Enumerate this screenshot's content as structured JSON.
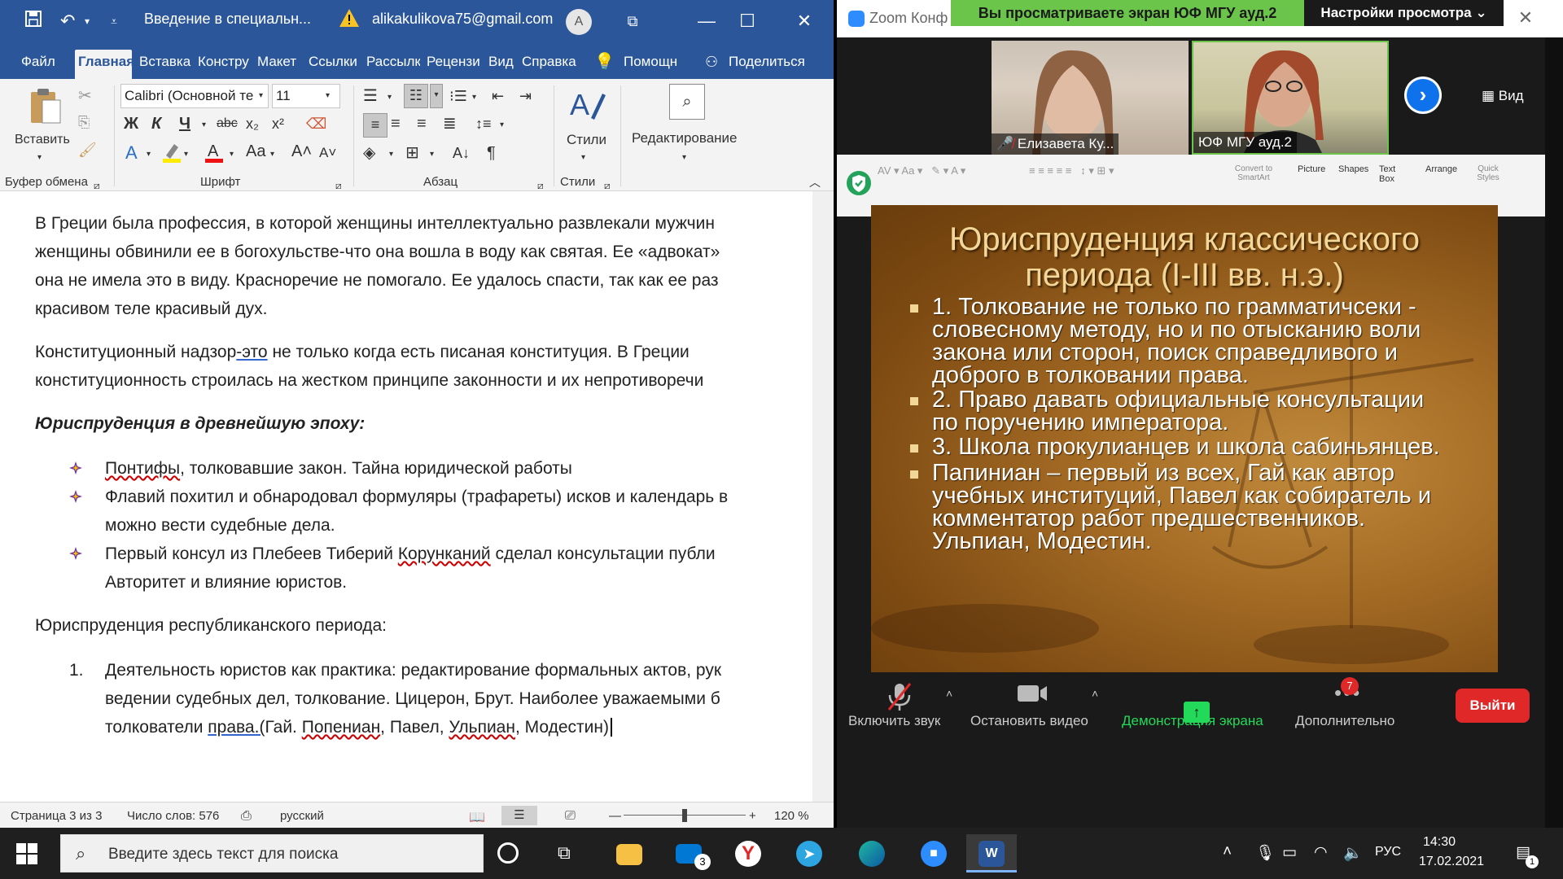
{
  "word": {
    "doc_title": "Введение в специальн...",
    "account_email": "alikakulikova75@gmail.com",
    "avatar_initial": "A",
    "tabs": [
      "Файл",
      "Главная",
      "Вставка",
      "Констру",
      "Макет",
      "Ссылки",
      "Рассылк",
      "Рецензи",
      "Вид",
      "Справка"
    ],
    "help_label": "Помощн",
    "share_label": "Поделиться",
    "ribbon": {
      "paste_label": "Вставить",
      "clipboard_group": "Буфер обмена",
      "font_group": "Шрифт",
      "paragraph_group": "Абзац",
      "styles_group": "Стили",
      "styles_label": "Стили",
      "editing_label": "Редактирование",
      "font_name": "Calibri (Основной те",
      "font_size": "11"
    },
    "document": {
      "p1_lines": [
        "В Греции была профессия, в которой женщины интеллектуально развлекали мужчин",
        "женщины обвинили ее в богохульстве-что она вошла в воду как святая. Ее «адвокат»",
        "она не имела это в виду. Красноречие не помогало. Ее удалось спасти, так как ее раз",
        "красивом теле красивый дух."
      ],
      "p2_a": "Конституционный надзор",
      "p2_b": "-это",
      "p2_c": " не только когда есть писаная конституция. В Греции",
      "p2_line2": "конституционность строилась на жестком принципе законности и их непротиворечи",
      "heading1": "Юриспруденция в древнейшую эпоху:",
      "b1_a": "Понтифы",
      "b1_b": ", толковавшие закон. Тайна юридической работы",
      "b2_line1": "Флавий похитил и обнародовал формуляры (трафареты) исков и календарь в",
      "b2_line2": "можно вести судебные дела.",
      "b3_a": "Первый консул из Плебеев Тиберий ",
      "b3_b": "Корунканий",
      "b3_c": " сделал консультации публи",
      "b3_line2": "Авторитет и влияние юристов.",
      "heading2": "Юриспруденция республиканского периода:",
      "n1_num": "1.",
      "n1_line1": "Деятельность юристов как практика: редактирование формальных актов, рук",
      "n1_line2": "ведении судебных дел, толкование. Цицерон, Брут. Наиболее уважаемыми б",
      "n1_l3_a": "толкователи ",
      "n1_l3_b": "права.(",
      "n1_l3_c": "Гай. ",
      "n1_l3_d": "Попениан",
      "n1_l3_e": ", Павел, ",
      "n1_l3_f": "Ульпиан",
      "n1_l3_g": ", Модестин)"
    },
    "status": {
      "page": "Страница 3 из 3",
      "words": "Число слов: 576",
      "language": "русский",
      "zoom": "120 %"
    }
  },
  "zoom": {
    "app_title": "Zoom Конф",
    "banner": "Вы просматриваете экран ЮФ МГУ ауд.2",
    "view_options": "Настройки просмотра",
    "view_button": "Вид",
    "participants": [
      {
        "name": "Елизавета Ку..."
      },
      {
        "name": "ЮФ МГУ ауд.2"
      }
    ],
    "ppt_ribbon": [
      "Convert to SmartArt",
      "Picture",
      "Shapes",
      "Text Box",
      "Arrange",
      "Quick Styles"
    ],
    "slide": {
      "title_line1": "Юриспруденция классического",
      "title_line2": "периода (I-III вв. н.э.)",
      "bullets": [
        [
          "1. Толкование не только по грамматичсеки -",
          "словесному методу, но и по отысканию воли",
          "закона или сторон, поиск справедливого и",
          "доброго в толковании права."
        ],
        [
          "2. Право давать официальные консультации",
          "по поручению императора."
        ],
        [
          "3. Школа прокулианцев и школа сабиньянцев."
        ],
        [
          "Папиниан – первый из всех, Гай как автор",
          "учебных институций, Павел как собиратель и",
          "комментатор работ предшественников.",
          "Ульпиан, Модестин."
        ]
      ]
    },
    "controls": {
      "unmute": "Включить звук",
      "stop_video": "Остановить видео",
      "share": "Демонстрация экрана",
      "more": "Дополнительно",
      "more_badge": "7",
      "leave": "Выйти"
    }
  },
  "taskbar": {
    "search_placeholder": "Введите здесь текст для поиска",
    "mail_badge": "3",
    "lang": "РУС",
    "time": "14:30",
    "date": "17.02.2021",
    "notif_badge": "1"
  }
}
